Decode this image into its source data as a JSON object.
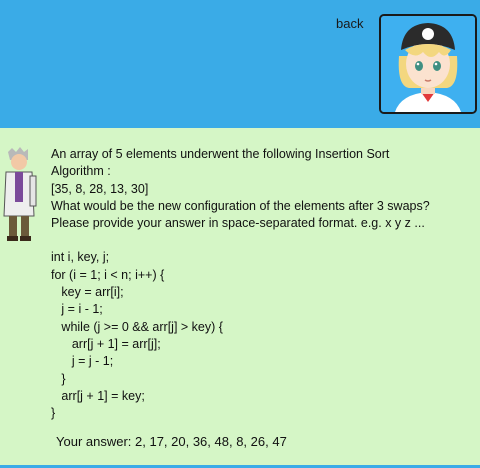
{
  "header": {
    "back_label": "back"
  },
  "question": {
    "lines": [
      "An array of 5 elements underwent the following Insertion Sort",
      "Algorithm :",
      "[35, 8, 28, 13, 30]",
      "What would be the new configuration of the elements after 3 swaps?",
      "Please provide your answer in space-separated format. e.g. x y z ..."
    ],
    "code": [
      "int i, key, j;",
      "for (i = 1; i < n; i++) {",
      "   key = arr[i];",
      "   j = i - 1;",
      "   while (j >= 0 && arr[j] > key) {",
      "      arr[j + 1] = arr[j];",
      "      j = j - 1;",
      "   }",
      "   arr[j + 1] = key;",
      "}"
    ]
  },
  "answer": {
    "text": "Your answer: 2, 17, 20, 36, 48, 8, 26, 47"
  }
}
